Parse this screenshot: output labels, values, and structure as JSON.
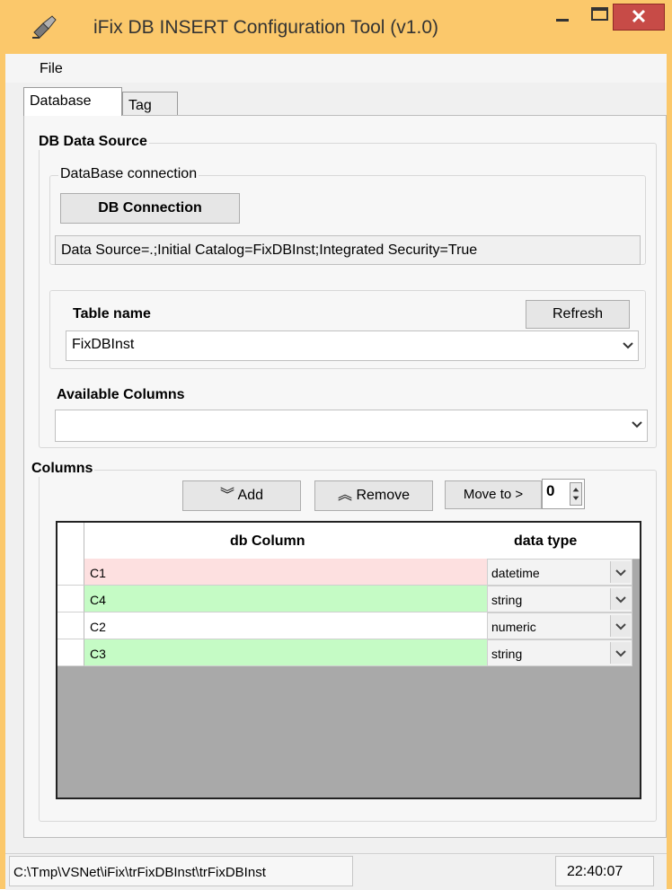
{
  "window": {
    "title": "iFix DB INSERT Configuration Tool (v1.0)",
    "min_label": "–",
    "max_label": "□",
    "close_label": "✕",
    "frame_color": "#fbc86b",
    "close_color": "#c74b47"
  },
  "menu": {
    "items": [
      "File"
    ]
  },
  "tabs": [
    {
      "label": "Database",
      "active": true
    },
    {
      "label": "Tag",
      "active": false
    }
  ],
  "db_data_source": {
    "group_label": "DB Data Source",
    "connection_group_label": "DataBase connection",
    "connection_button": "DB Connection",
    "connection_string": "Data Source=.;Initial Catalog=FixDBInst;Integrated Security=True"
  },
  "table": {
    "label": "Table name",
    "refresh_button": "Refresh",
    "selected": "FixDBInst"
  },
  "available_columns": {
    "label": "Available Columns",
    "selected": ""
  },
  "columns": {
    "group_label": "Columns",
    "add_button": "Add",
    "remove_button": "Remove",
    "move_to_button": "Move to >",
    "move_to_value": "0",
    "headers": {
      "name": "db Column",
      "type": "data type"
    },
    "rows": [
      {
        "name": "C1",
        "type": "datetime",
        "color": "#fde0e0"
      },
      {
        "name": "C4",
        "type": "string",
        "color": "#c5fbc5"
      },
      {
        "name": "C2",
        "type": "numeric",
        "color": "#ffffff"
      },
      {
        "name": "C3",
        "type": "string",
        "color": "#c5fbc5"
      }
    ]
  },
  "status": {
    "path": "C:\\Tmp\\VSNet\\iFix\\trFixDBInst\\trFixDBInst",
    "time": "22:40:07"
  }
}
